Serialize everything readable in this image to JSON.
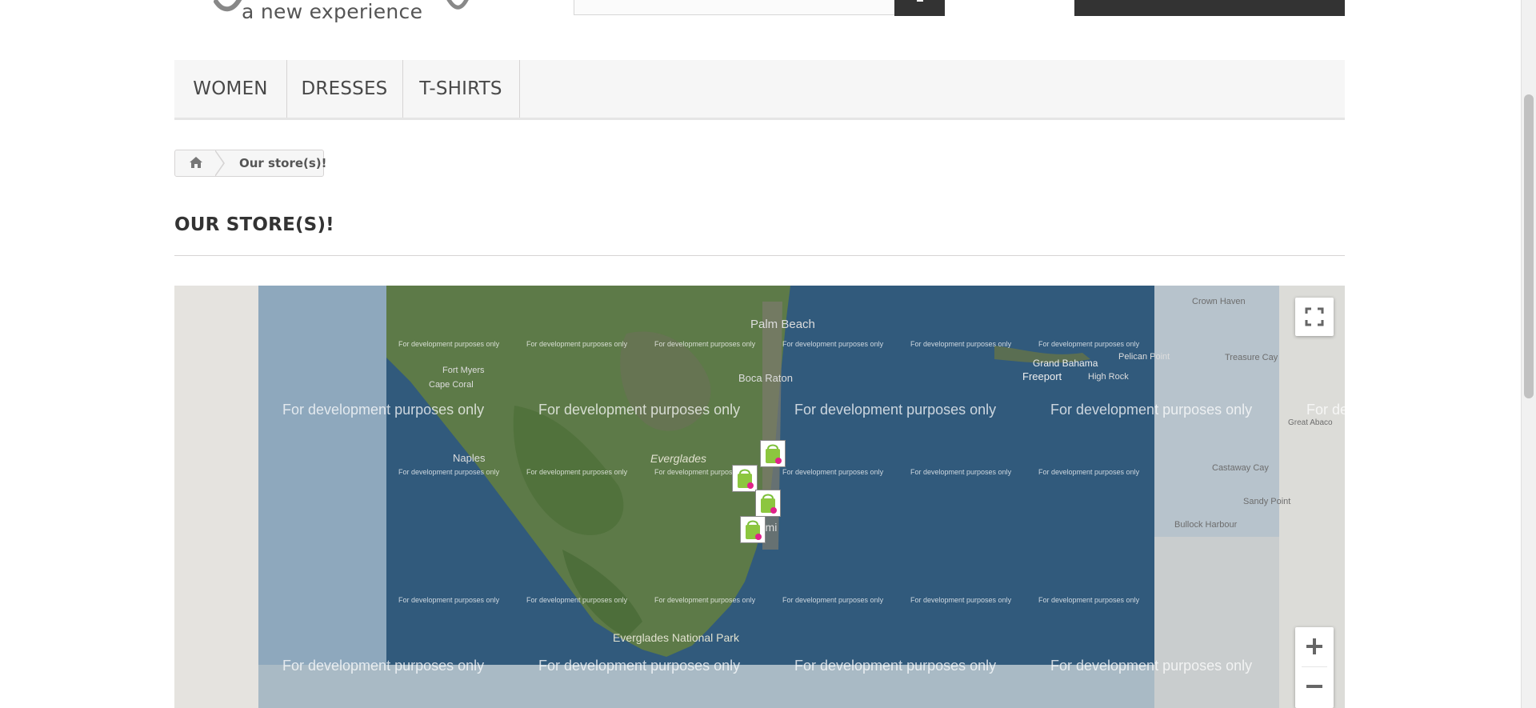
{
  "header": {
    "logo_tagline": "a new experience",
    "search_button_icon": "search-icon"
  },
  "menu": {
    "items": [
      {
        "label": "WOMEN"
      },
      {
        "label": "DRESSES"
      },
      {
        "label": "T-SHIRTS"
      }
    ]
  },
  "breadcrumb": {
    "home_icon": "home-icon",
    "current": "Our store(s)!"
  },
  "page": {
    "title": "OUR STORE(S)!"
  },
  "map": {
    "watermark": "For development purposes only",
    "places": {
      "crown_haven": "Crown Haven",
      "grand_bahama": "Grand Bahama",
      "freeport": "Freeport",
      "high_rock": "High Rock",
      "pelican_point": "Pelican Point",
      "treasure_cay": "Treasure Cay",
      "great_abaco": "Great Abaco",
      "castaway_cay": "Castaway Cay",
      "sandy_point": "Sandy Point",
      "bullock_harbour": "Bullock Harbour",
      "everglades": "Everglades",
      "everglades_np": "Everglades National Park",
      "fort_myers": "Fort Myers",
      "cape_coral": "Cape Coral",
      "naples": "Naples",
      "palm_beach": "Palm Beach",
      "boca_raton": "Boca Raton",
      "miami": "Miami"
    },
    "marker_count": 4,
    "marker_icon": "store-bag-icon",
    "colors": {
      "water": "#315a7c",
      "land": "#5a7d44",
      "outer_land": "#c8cdd0",
      "bg": "#e5e3df"
    }
  }
}
